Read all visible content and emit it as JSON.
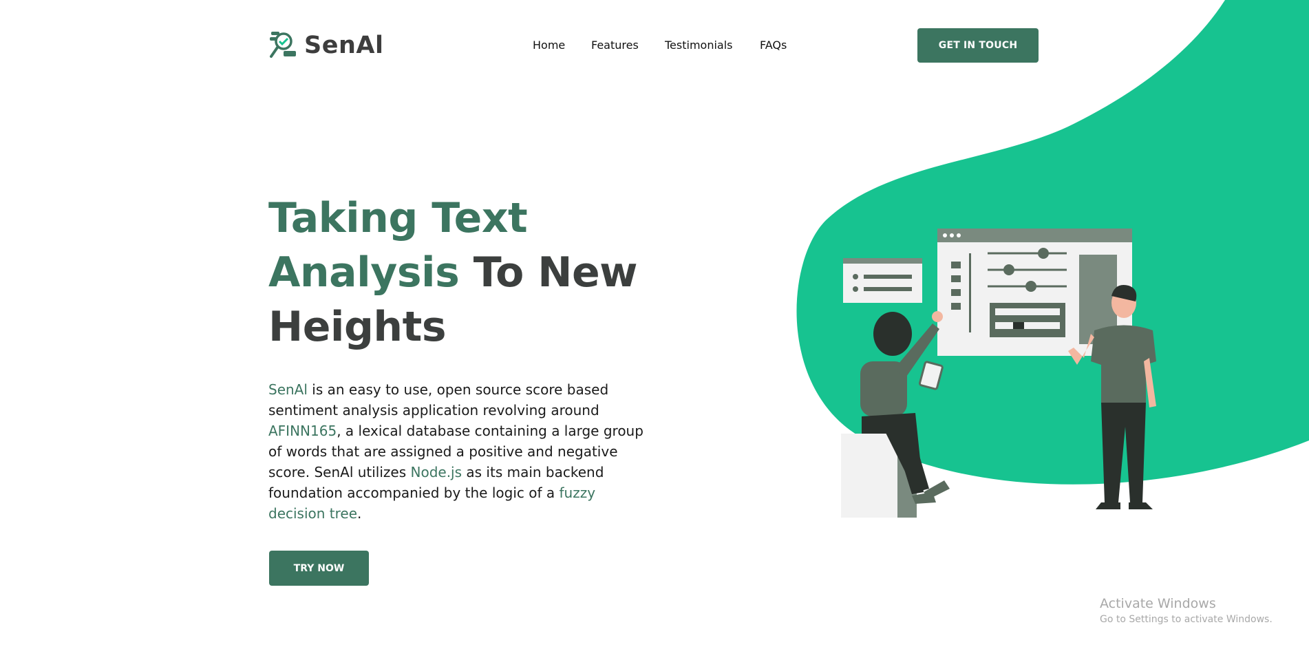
{
  "brand": {
    "name": "SenAl"
  },
  "nav": {
    "items": [
      "Home",
      "Features",
      "Testimonials",
      "FAQs"
    ],
    "cta_label": "GET IN TOUCH"
  },
  "hero": {
    "title_accent_1": "Taking Text",
    "title_accent_2": "Analysis",
    "title_rest_1": " To New",
    "title_rest_2": "Heights",
    "desc": {
      "link_senai": "SenAl",
      "t1": " is an easy to use, open source score based sentiment analysis application revolving around ",
      "link_afinn": "AFINN165",
      "t2": ", a lexical database containing a large group of words that are assigned a positive and negative score. SenAl utilizes ",
      "link_node": "Node.js",
      "t3": " as its main backend foundation accompanied by the logic of a ",
      "link_fuzzy": "fuzzy decision tree",
      "t4": "."
    },
    "button_label": "TRY NOW"
  },
  "watermark": {
    "line1": "Activate Windows",
    "line2": "Go to Settings to activate Windows."
  },
  "colors": {
    "primary": "#3c7560",
    "blob": "#17c390",
    "heading_dark": "#3c3f3e"
  },
  "icons": {
    "logo": "magnifier-check-icon"
  }
}
